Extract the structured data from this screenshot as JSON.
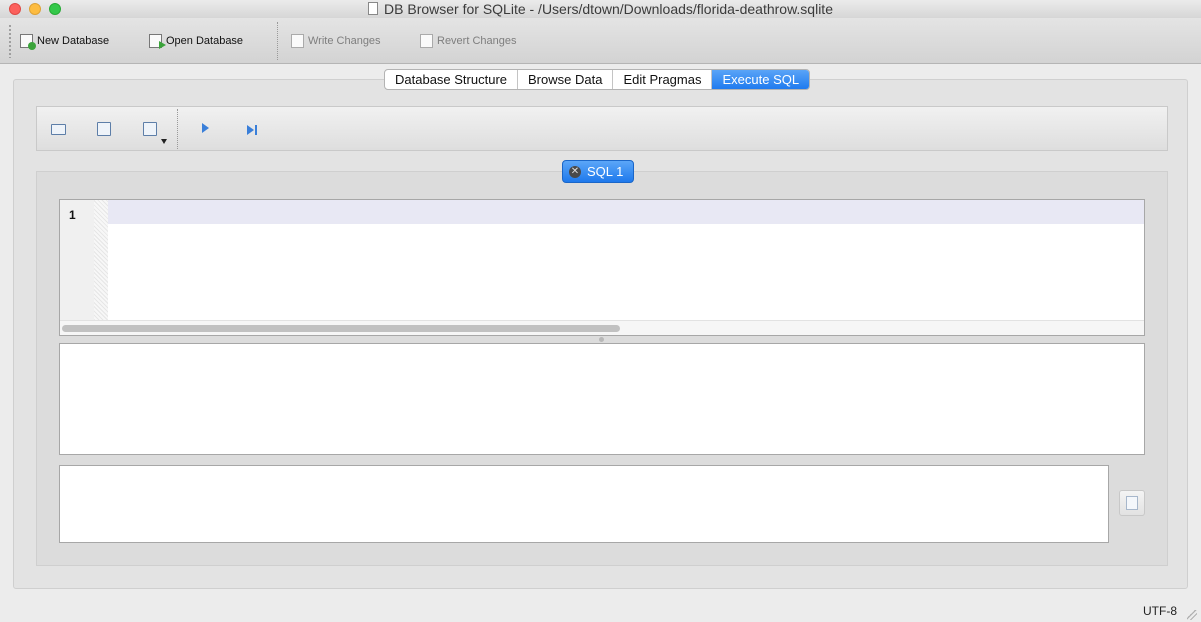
{
  "window": {
    "title": "DB Browser for SQLite - /Users/dtown/Downloads/florida-deathrow.sqlite"
  },
  "toolbar": {
    "new_database": "New Database",
    "open_database": "Open Database",
    "write_changes": "Write Changes",
    "revert_changes": "Revert Changes"
  },
  "tabs": [
    {
      "label": "Database Structure",
      "active": false
    },
    {
      "label": "Browse Data",
      "active": false
    },
    {
      "label": "Edit Pragmas",
      "active": false
    },
    {
      "label": "Execute SQL",
      "active": true
    }
  ],
  "sql_tab": {
    "label": "SQL 1"
  },
  "editor": {
    "line_numbers": [
      "1"
    ],
    "content": ""
  },
  "status": {
    "encoding": "UTF-8"
  },
  "colors": {
    "accent": "#1f7bef",
    "close_red": "#fc605c",
    "minimize_yellow": "#fdbc40",
    "maximize_green": "#34c84a"
  }
}
